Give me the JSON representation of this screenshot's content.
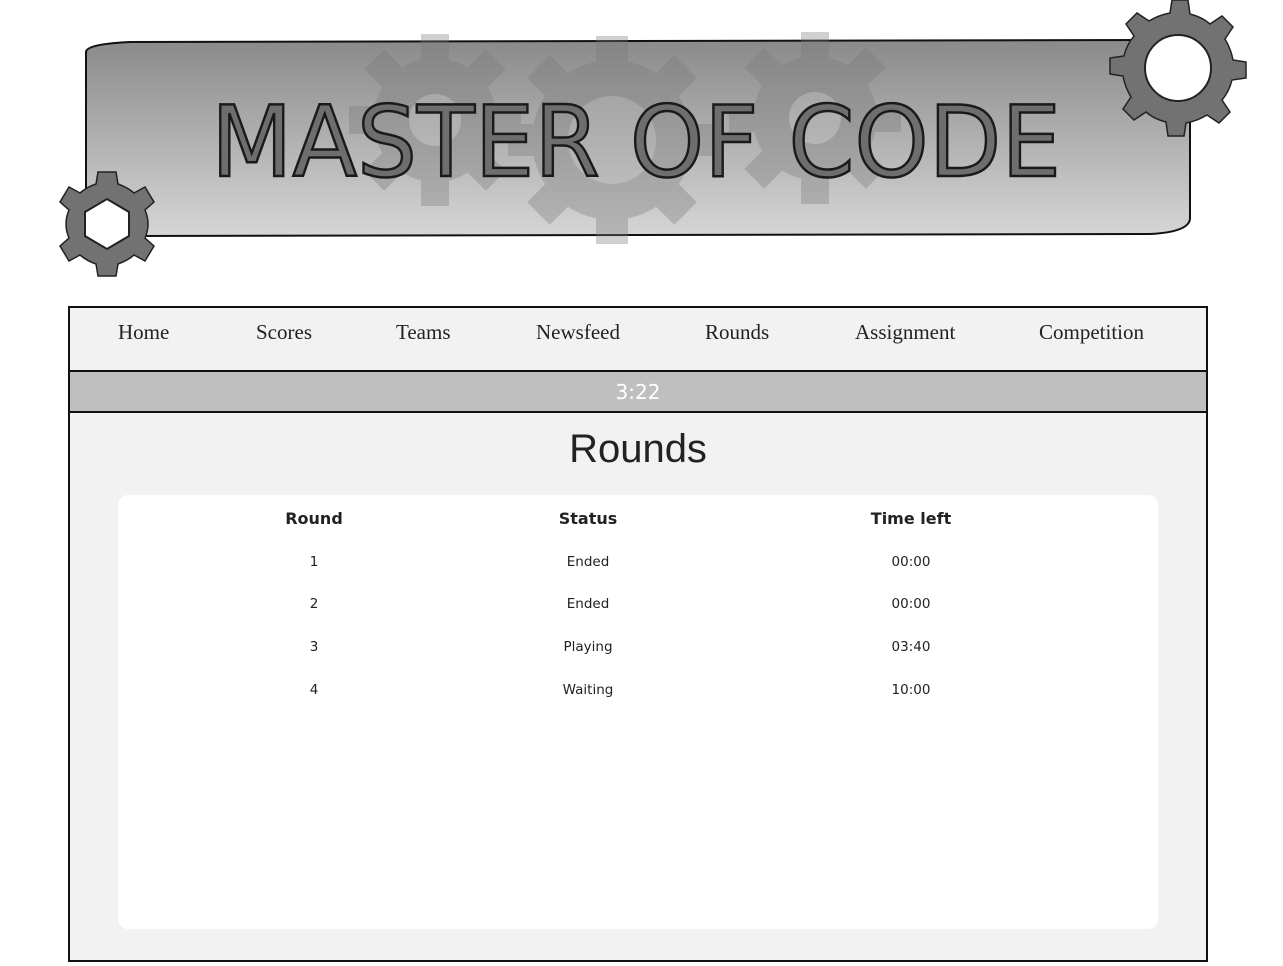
{
  "banner": {
    "title": "MASTER OF CODE"
  },
  "nav": {
    "items": [
      {
        "label": "Home"
      },
      {
        "label": "Scores"
      },
      {
        "label": "Teams"
      },
      {
        "label": "Newsfeed"
      },
      {
        "label": "Rounds"
      },
      {
        "label": "Assignment"
      },
      {
        "label": "Competition"
      }
    ]
  },
  "timer": {
    "value": "3:22"
  },
  "main": {
    "title": "Rounds",
    "table": {
      "headers": [
        "Round",
        "Status",
        "Time left"
      ],
      "rows": [
        [
          "1",
          "Ended",
          "00:00"
        ],
        [
          "2",
          "Ended",
          "00:00"
        ],
        [
          "3",
          "Playing",
          "03:40"
        ],
        [
          "4",
          "Waiting",
          "10:00"
        ]
      ]
    }
  },
  "icons": {
    "gear": "gear-icon"
  },
  "colors": {
    "banner_dark": "#8a8a8a",
    "banner_light": "#d4d4d4",
    "gear_fill": "#6f6f6f",
    "timer_bar": "#bfbfbf",
    "panel": "#f2f2f2"
  }
}
